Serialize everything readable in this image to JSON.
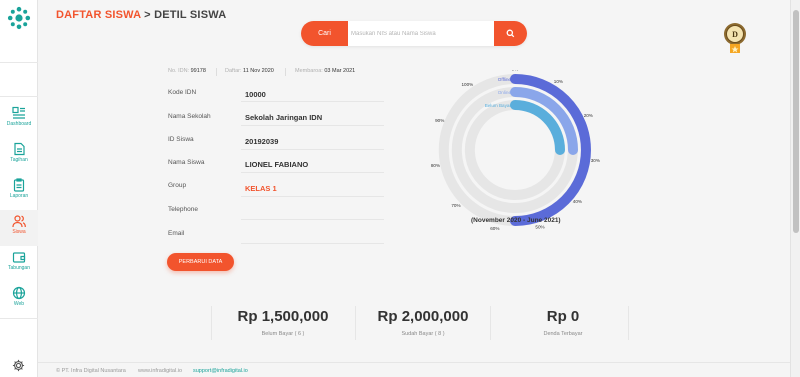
{
  "breadcrumb": {
    "parent": "DAFTAR SISWA",
    "separator": ">",
    "current": "DETIL SISWA"
  },
  "search": {
    "button_label": "Cari",
    "placeholder": "Masukan NIS atau Nama Siswa",
    "value": ""
  },
  "user_badge": {
    "initial": "D"
  },
  "sidebar": {
    "items": [
      {
        "label": "Dashboard",
        "icon": "dashboard-icon"
      },
      {
        "label": "Tagihan",
        "icon": "bill-icon"
      },
      {
        "label": "Laporan",
        "icon": "report-icon"
      },
      {
        "label": "Siswa",
        "icon": "users-icon",
        "active": true
      },
      {
        "label": "Tabungan",
        "icon": "wallet-icon"
      },
      {
        "label": "Web",
        "icon": "globe-icon"
      }
    ]
  },
  "meta": {
    "idn_key": "No. IDN:",
    "idn_val": "99178",
    "daftar_key": "Daftar:",
    "daftar_val": "11 Nov 2020",
    "member_key": "Membaroa:",
    "member_val": "03 Mar 2021"
  },
  "fields": [
    {
      "label": "Kode IDN",
      "value": "10000"
    },
    {
      "label": "Nama Sekolah",
      "value": "Sekolah Jaringan IDN"
    },
    {
      "label": "ID Siswa",
      "value": "20192039"
    },
    {
      "label": "Nama Siswa",
      "value": "LIONEL FABIANO"
    },
    {
      "label": "Group",
      "value": "KELAS 1"
    },
    {
      "label": "Telephone",
      "value": ""
    },
    {
      "label": "Email",
      "value": ""
    }
  ],
  "update_button": "PERBARUI DATA",
  "chart_data": {
    "type": "radial-bar",
    "caption": "(November 2020 - June 2021)",
    "series": [
      {
        "name": "Offline",
        "value": 50,
        "color": "#5b6bd8"
      },
      {
        "name": "Online",
        "value": 25,
        "color": "#8aa6ea"
      },
      {
        "name": "Belum Bayar",
        "value": 25,
        "color": "#5aaedc"
      }
    ],
    "track_color": "#e6e6e6",
    "tick_labels": [
      "0%",
      "10%",
      "20%",
      "30%",
      "40%",
      "50%",
      "60%",
      "70%",
      "80%",
      "90%",
      "100%"
    ]
  },
  "summary": [
    {
      "amount": "Rp 1,500,000",
      "caption": "Belum Bayar ( 6 )"
    },
    {
      "amount": "Rp 2,000,000",
      "caption": "Sudah Bayar ( 8 )"
    },
    {
      "amount": "Rp 0",
      "caption": "Denda Terbayar"
    }
  ],
  "footer": {
    "company": "© PT. Infra Digital Nusantara",
    "site": "www.infradigital.io",
    "email": "support@infradigital.io"
  },
  "colors": {
    "accent": "#f2542d",
    "teal": "#1aa39a"
  }
}
